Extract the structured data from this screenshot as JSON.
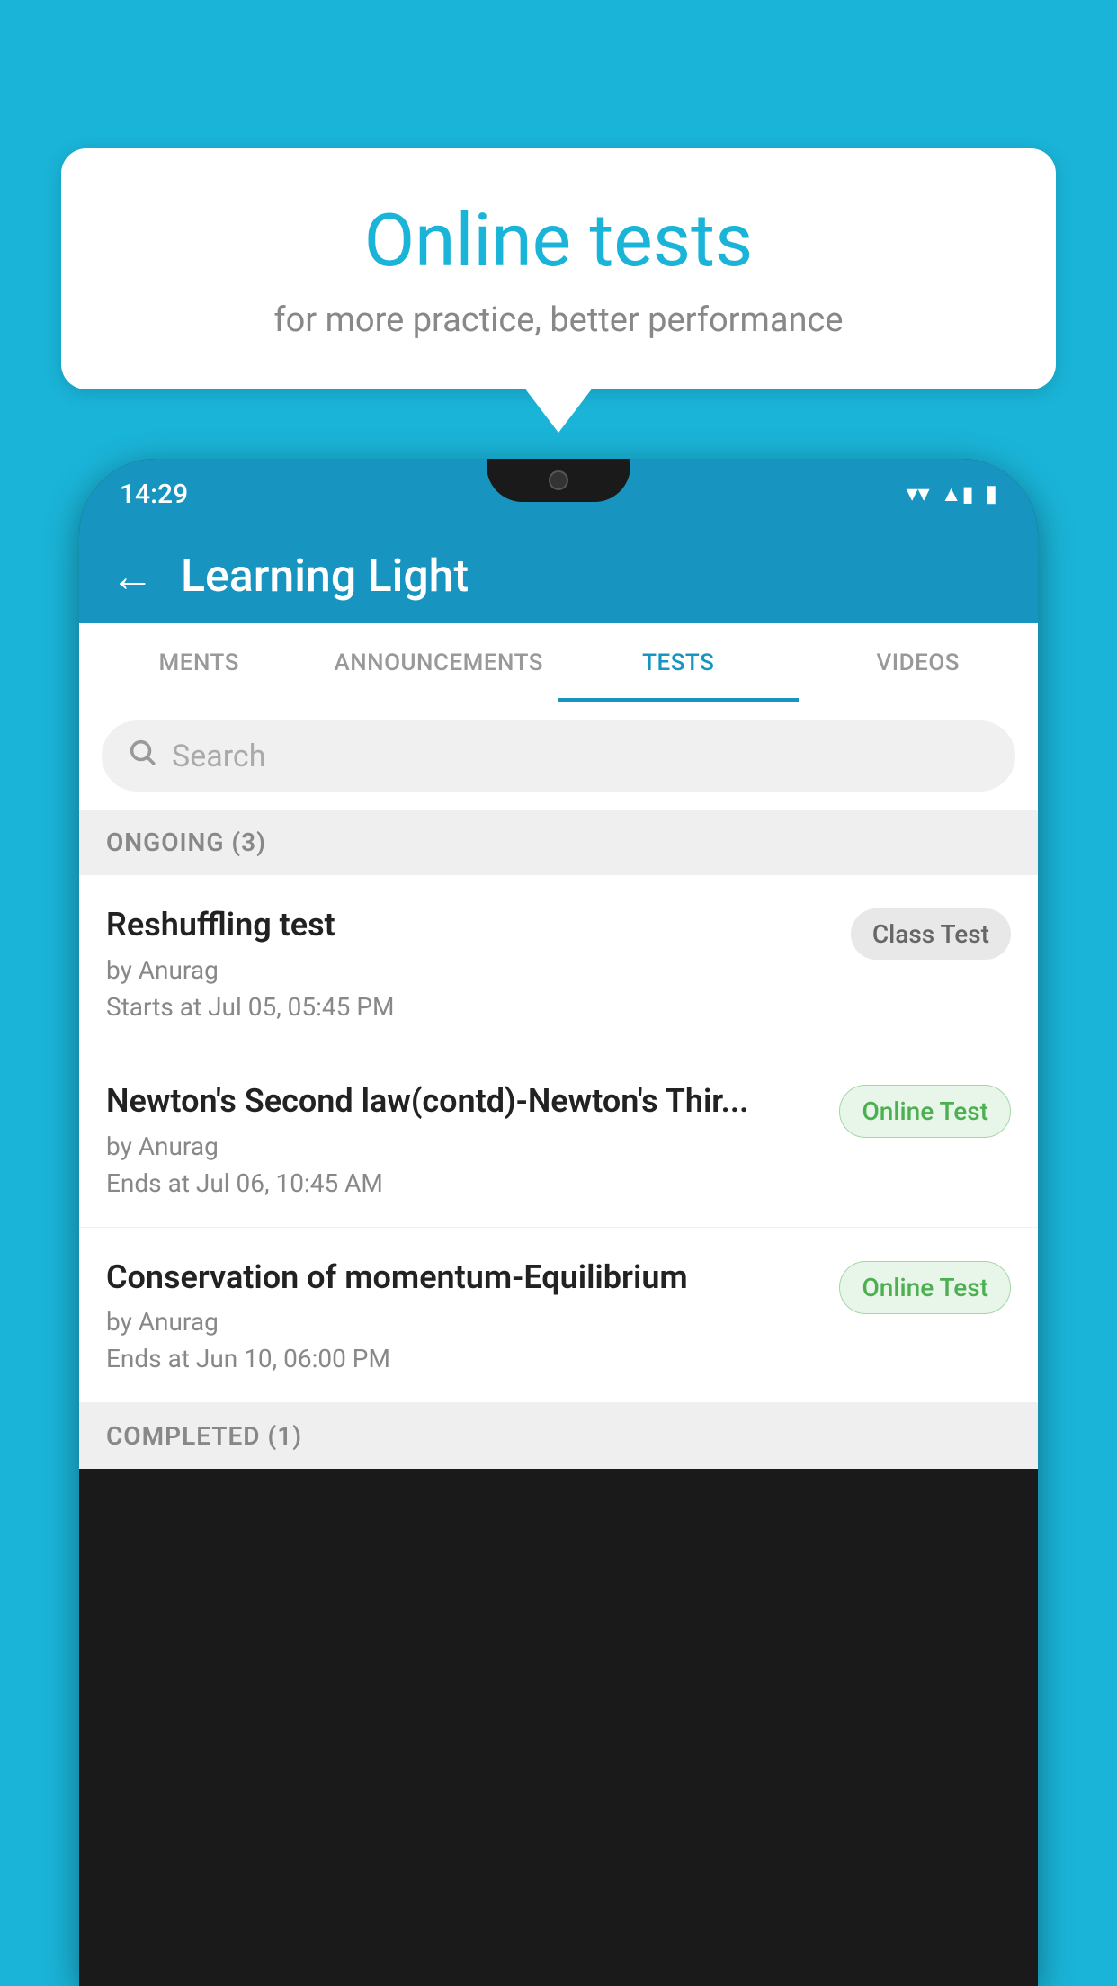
{
  "background": {
    "color": "#1ab4d8"
  },
  "bubble": {
    "title": "Online tests",
    "subtitle": "for more practice, better performance"
  },
  "phone": {
    "status_bar": {
      "time": "14:29",
      "wifi": "▼",
      "signal": "▲",
      "battery": "▮"
    },
    "header": {
      "back_label": "←",
      "title": "Learning Light"
    },
    "tabs": [
      {
        "label": "MENTS",
        "active": false
      },
      {
        "label": "ANNOUNCEMENTS",
        "active": false
      },
      {
        "label": "TESTS",
        "active": true
      },
      {
        "label": "VIDEOS",
        "active": false
      }
    ],
    "search": {
      "placeholder": "Search"
    },
    "sections": [
      {
        "title": "ONGOING (3)",
        "items": [
          {
            "name": "Reshuffling test",
            "author": "by Anurag",
            "date": "Starts at  Jul 05, 05:45 PM",
            "badge": "Class Test",
            "badge_type": "class"
          },
          {
            "name": "Newton's Second law(contd)-Newton's Thir...",
            "author": "by Anurag",
            "date": "Ends at  Jul 06, 10:45 AM",
            "badge": "Online Test",
            "badge_type": "online"
          },
          {
            "name": "Conservation of momentum-Equilibrium",
            "author": "by Anurag",
            "date": "Ends at  Jun 10, 06:00 PM",
            "badge": "Online Test",
            "badge_type": "online"
          }
        ]
      },
      {
        "title": "COMPLETED (1)",
        "items": []
      }
    ]
  }
}
